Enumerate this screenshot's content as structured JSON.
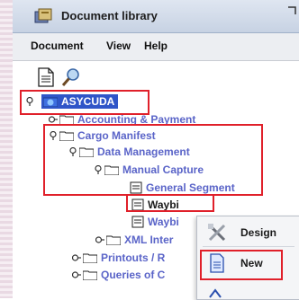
{
  "window": {
    "title": "Document library"
  },
  "menu": [
    "Document",
    "View",
    "Help"
  ],
  "toolbar": {
    "items": [
      "new-document-icon",
      "search-icon"
    ]
  },
  "tree": [
    {
      "label": "ASYCUDA"
    },
    {
      "label": "Accounting & Payment"
    },
    {
      "label": "Cargo Manifest"
    },
    {
      "label": "Data Management"
    },
    {
      "label": "Manual Capture"
    },
    {
      "label": "General Segment"
    },
    {
      "label": "Waybi"
    },
    {
      "label": "Waybi"
    },
    {
      "label": "XML Inter"
    },
    {
      "label": "Printouts / R"
    },
    {
      "label": "Queries of C"
    }
  ],
  "context_menu": {
    "items": [
      {
        "label": "Design",
        "icon": "design-tools-icon"
      },
      {
        "label": "New",
        "icon": "new-document-icon"
      }
    ]
  },
  "colors": {
    "highlight": "#e0202a",
    "tree_text": "#5a64c8",
    "selection": "#2f55c8"
  }
}
